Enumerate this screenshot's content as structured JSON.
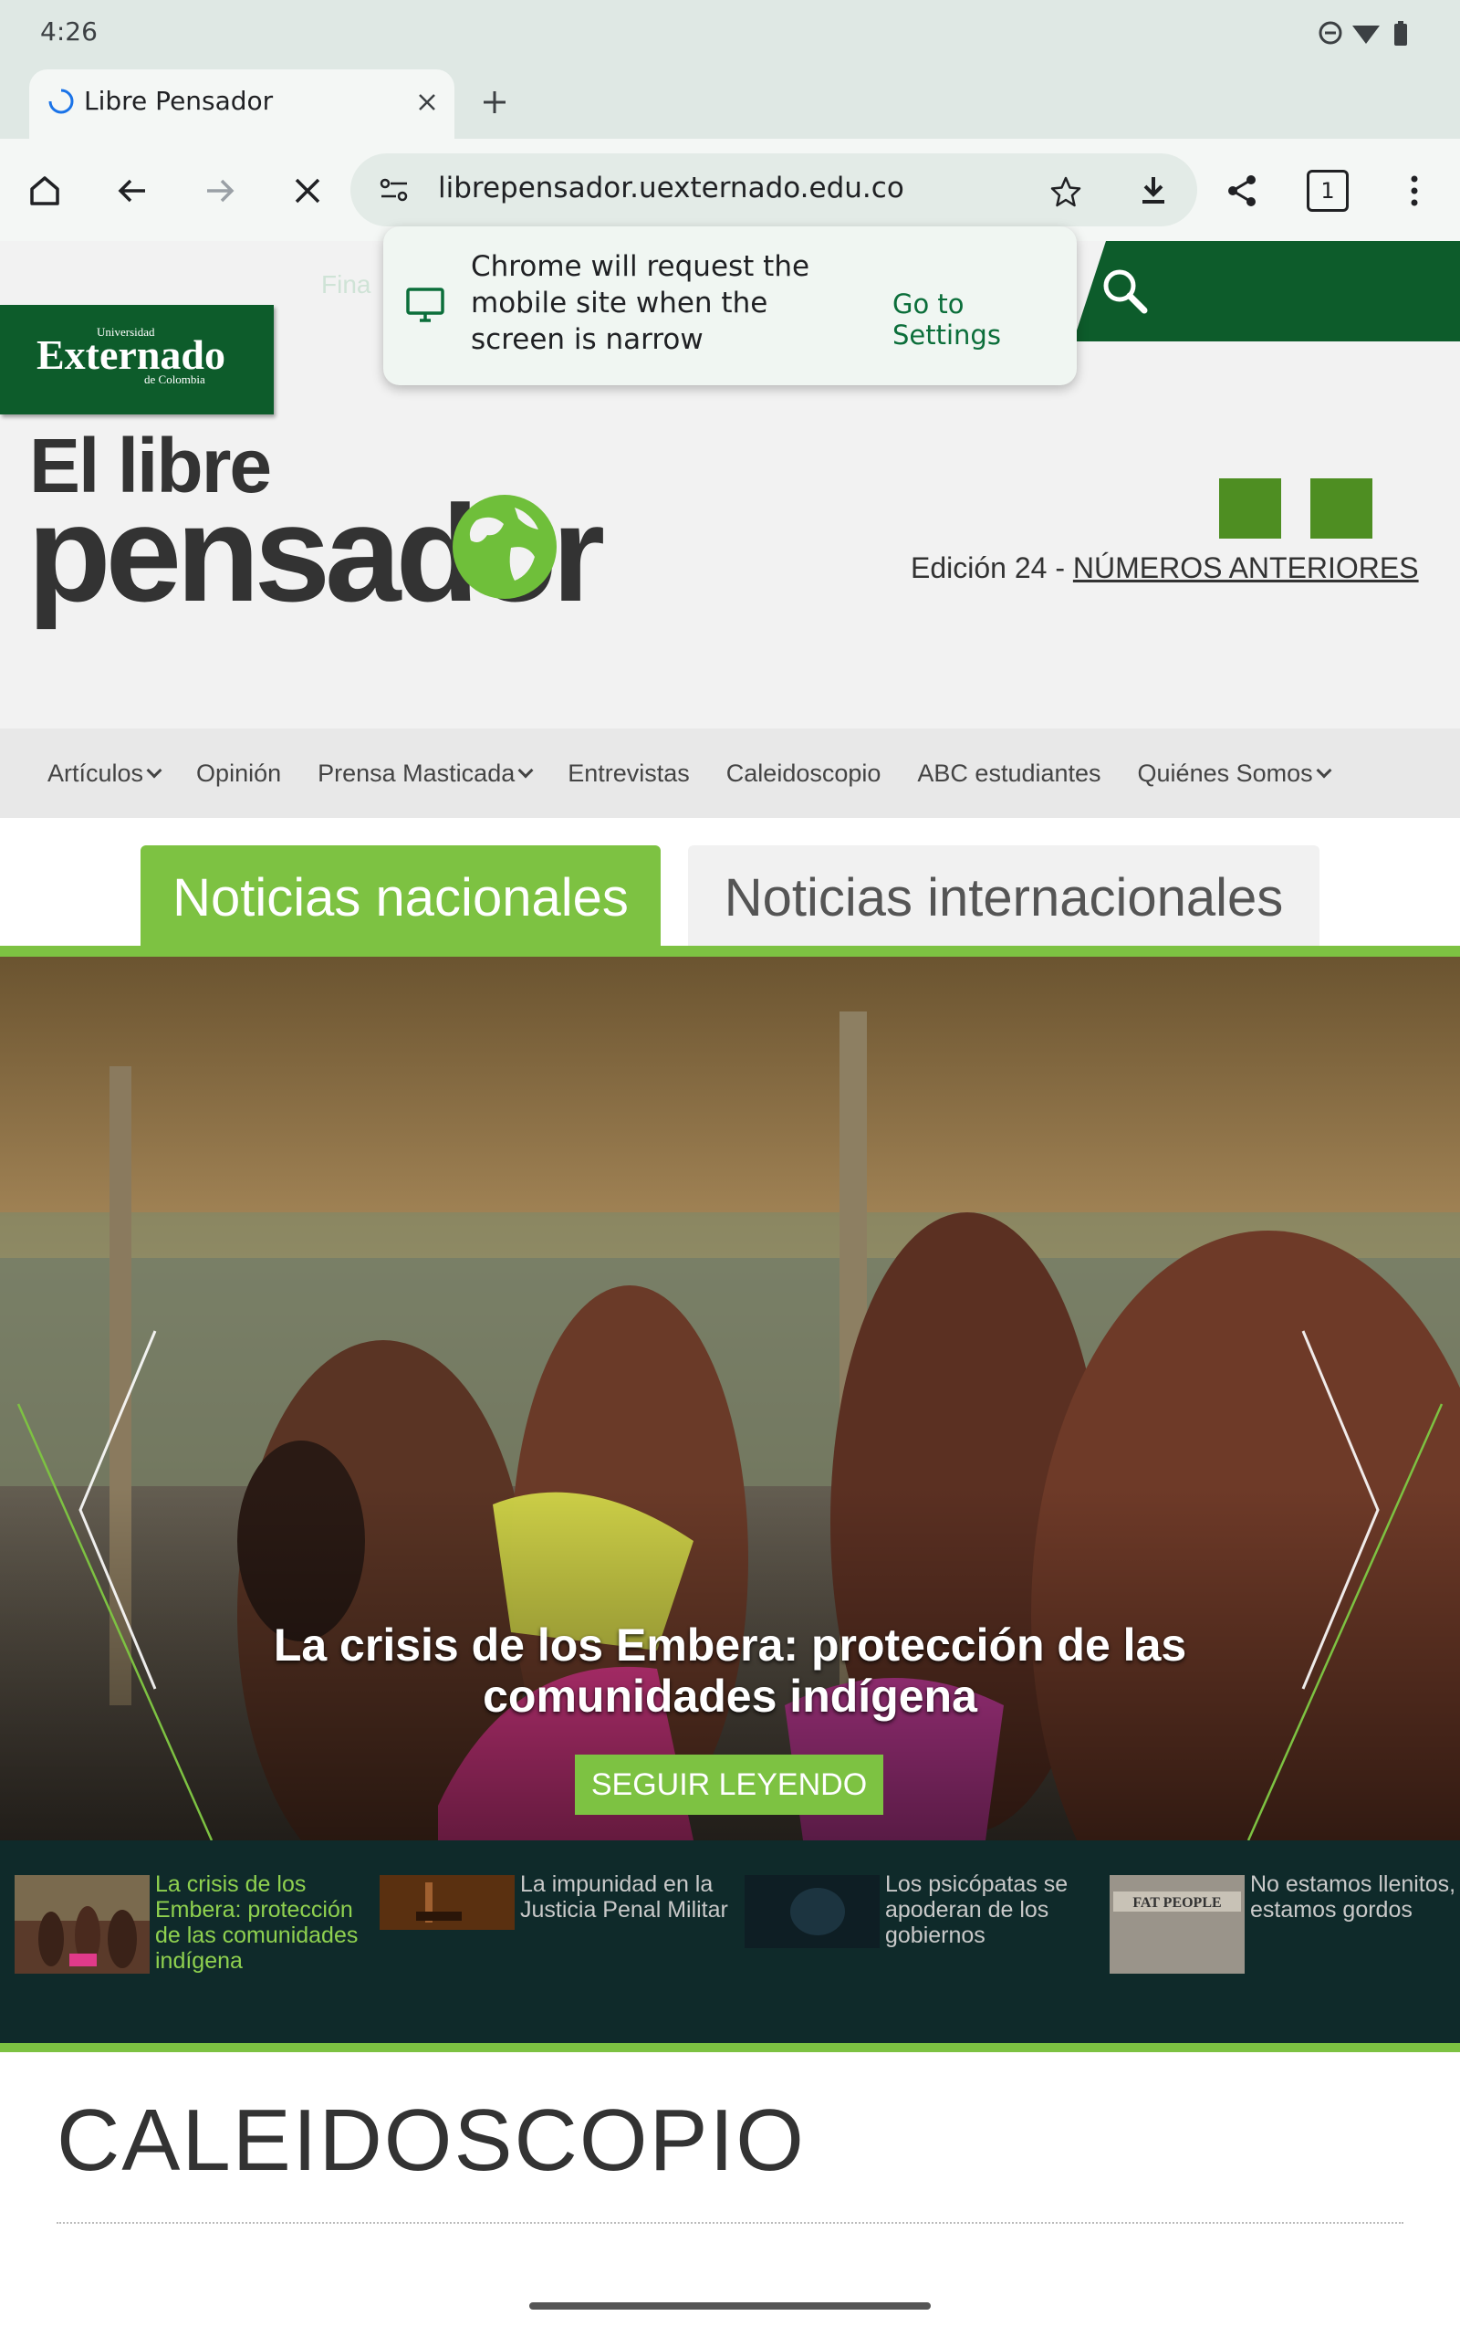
{
  "status": {
    "time": "4:26"
  },
  "browser": {
    "tab_title": "Libre Pensador",
    "url": "librepensador.uexternado.edu.co",
    "tab_count": "1"
  },
  "popup": {
    "message": "Chrome will request the mobile site when the screen is narrow",
    "link": "Go to Settings"
  },
  "site": {
    "header_faded": "Fina",
    "uext_small_top": "Universidad",
    "uext_name": "Externado",
    "uext_small_bottom": "de Colombia",
    "brand_line1": "El libre",
    "brand_line2": "pensador",
    "edition": "Edición 24 - ",
    "edition_link": "NÚMEROS ANTERIORES"
  },
  "nav": {
    "items": [
      {
        "label": "Artículos",
        "dropdown": true
      },
      {
        "label": "Opinión",
        "dropdown": false
      },
      {
        "label": "Prensa Masticada",
        "dropdown": true
      },
      {
        "label": "Entrevistas",
        "dropdown": false
      },
      {
        "label": "Caleidoscopio",
        "dropdown": false
      },
      {
        "label": "ABC estudiantes",
        "dropdown": false
      },
      {
        "label": "Quiénes Somos",
        "dropdown": true
      }
    ]
  },
  "news_tabs": {
    "national": "Noticias nacionales",
    "international": "Noticias internacionales"
  },
  "hero": {
    "title": "La crisis de los Embera: protección de las comunidades indígena",
    "button": "SEGUIR LEYENDO"
  },
  "thumbs": [
    {
      "text": "La crisis de los Embera: protección de las comunidades indígena",
      "active": true
    },
    {
      "text": "La impunidad en la Justicia Penal Militar",
      "active": false
    },
    {
      "text": "Los psicópatas se apoderan de los gobiernos",
      "active": false
    },
    {
      "text": "No estamos llenitos, estamos gordos",
      "active": false
    }
  ],
  "thumb_image_text": "FAT PEOPLE",
  "section": {
    "title": "CALEIDOSCOPIO"
  },
  "colors": {
    "green_dark": "#0d5c2b",
    "green_light": "#7dc242",
    "strip_bg": "#0f2a2a"
  }
}
